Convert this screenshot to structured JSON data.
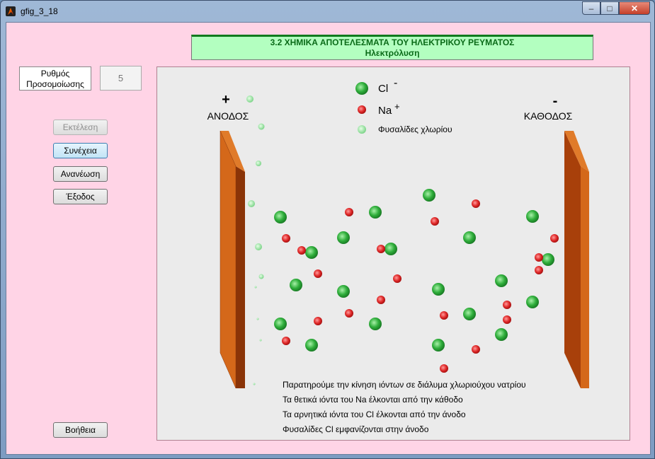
{
  "window": {
    "title": "gfig_3_18",
    "minimize": "–",
    "maximize": "□",
    "close": "✕"
  },
  "header": {
    "line1": "3.2 ΧΗΜΙΚΑ  ΑΠΟΤΕΛΕΣΜΑΤΑ ΤΟΥ ΗΛΕΚΤΡΙΚΟΥ ΡΕΥΜΑΤΟΣ",
    "line2": "Ηλεκτρόλυση"
  },
  "controls": {
    "rate_label_1": "Ρυθμός",
    "rate_label_2": "Προσομοίωσης",
    "rate_value": "5",
    "buttons": {
      "run": "Εκτέλεση",
      "continue": "Συνέχεια",
      "refresh": "Ανανέωση",
      "exit": "Έξοδος",
      "help": "Βοήθεια"
    }
  },
  "simulation": {
    "anode": {
      "sign": "+",
      "label": "ΑΝΟΔΟΣ"
    },
    "cathode": {
      "sign": "-",
      "label": "ΚΑΘΟΔΟΣ"
    },
    "legend": {
      "cl": "Cl",
      "cl_charge": "-",
      "na": "Na",
      "na_charge": "+",
      "bubbles": "Φυσαλίδες χλωρίου"
    },
    "colors": {
      "cl": "#2fae3b",
      "na": "#e02a2a",
      "bubble": "#8fe09a",
      "electrode": "#c25a0a"
    },
    "notes": [
      "Παρατηρούμε την κίνηση ιόντων σε διάλυμα χλωριούχου νατρίου",
      "Τα θετικά ιόντα του Na έλκονται από την κάθοδο",
      "Τα αρνητικά ιόντα του Cl έλκονται από την άνοδο",
      "Φυσαλίδες Cl εμφανίζονται στην άνοδο"
    ]
  }
}
